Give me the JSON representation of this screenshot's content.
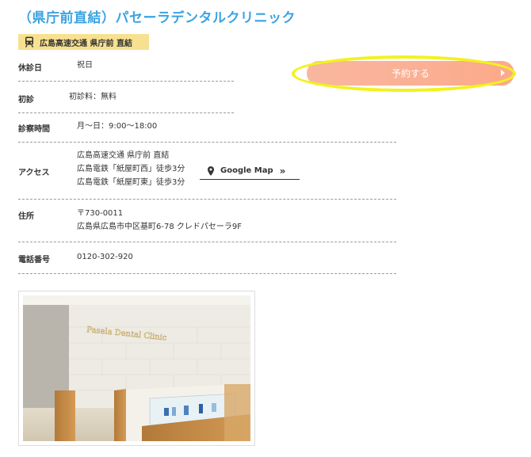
{
  "clinic": {
    "title": "（県庁前直結）パセーラデンタルクリニック"
  },
  "badge": {
    "text": "広島高速交通 県庁前 直結"
  },
  "booking": {
    "label": "予約する"
  },
  "rows": {
    "holiday": {
      "label": "休診日",
      "value": "祝日"
    },
    "first_visit": {
      "label": "初診",
      "value": "初診料：無料"
    },
    "hours": {
      "label": "診察時間",
      "value": "月～日：9:00～18:00"
    },
    "access": {
      "label": "アクセス",
      "lines": [
        "広島高速交通 県庁前 直結",
        "広島電鉄「紙屋町西」徒歩3分",
        "広島電鉄「紙屋町東」徒歩3分"
      ]
    },
    "address": {
      "label": "住所",
      "lines": [
        "〒730-0011",
        "広島県広島市中区基町6-78 クレドパセーラ9F"
      ]
    },
    "phone": {
      "label": "電話番号",
      "value": "0120-302-920"
    }
  },
  "map_link": {
    "label": "Google Map",
    "chevron": "»"
  },
  "photo": {
    "sign_text": "Pasela Dental Clinic"
  },
  "colors": {
    "title": "#3aa3e3",
    "badge": "#f7e08f",
    "button": "#fca98a",
    "highlight": "#f2f21e"
  }
}
